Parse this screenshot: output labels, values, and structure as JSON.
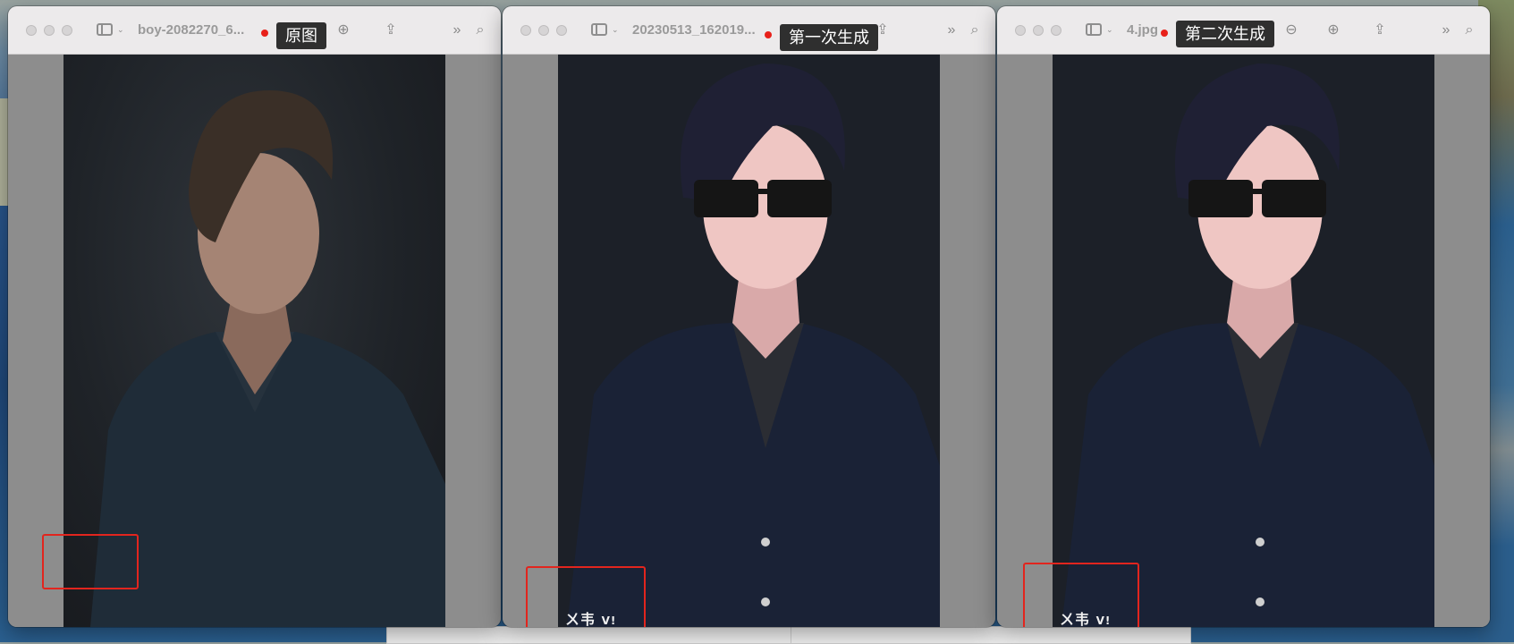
{
  "windows": [
    {
      "file_title": "boy-2082270_6...",
      "tooltip": "原图",
      "photo_style": "real"
    },
    {
      "file_title": "20230513_162019...",
      "tooltip": "第一次生成",
      "photo_style": "anime"
    },
    {
      "file_title": "4.jpg",
      "tooltip": "第二次生成",
      "photo_style": "anime"
    }
  ],
  "icons": {
    "sidebar": "sidebar-toggle-icon",
    "zoom_in": "zoom-in-icon",
    "zoom_out": "zoom-out-icon",
    "share": "share-icon",
    "more": "chevron-double-right-icon",
    "search": "search-icon"
  },
  "colors": {
    "highlight_box": "#e2251e",
    "title_dot": "#e8201a",
    "tooltip_bg": "#2f2f2f"
  }
}
